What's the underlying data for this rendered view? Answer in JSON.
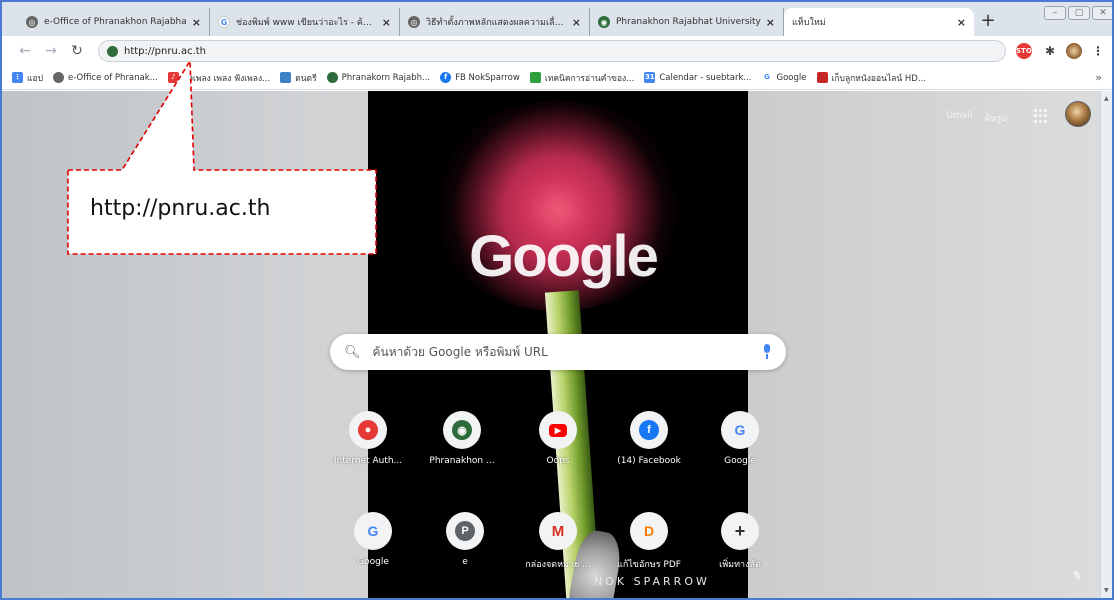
{
  "tabs": [
    {
      "title": "e-Office of Phranakhon Rajabha",
      "favicon": "globe-icon",
      "color": "#666666"
    },
    {
      "title": "ช่องพิมพ์ www เขียนว่าอะไร - ค้นหาใ",
      "favicon": "google-icon",
      "color": "#4285f4"
    },
    {
      "title": "วิธีทำตั้งภาพหลักแสดงผลความเลื่อนๆ",
      "favicon": "globe-icon",
      "color": "#666666"
    },
    {
      "title": "Phranakhon Rajabhat University",
      "favicon": "university-seal-icon",
      "color": "#2e6b3a"
    },
    {
      "title": "แท็บใหม่",
      "favicon": "",
      "color": ""
    }
  ],
  "toolbar": {
    "url": "http://pnru.ac.th",
    "extensions": [
      "stop-extension-icon",
      "puzzle-extension-icon",
      "profile-icon",
      "menu-icon"
    ]
  },
  "bookmarks": [
    {
      "label": "แอป",
      "icon": "apps-grid-icon",
      "color": "#4285f4"
    },
    {
      "label": "e-Office of Phranak...",
      "icon": "globe-icon",
      "color": "#666666"
    },
    {
      "label": "ฟังเพลง เพลง ฟังเพลง...",
      "icon": "music-icon",
      "color": "#e53935"
    },
    {
      "label": "ดนตรี",
      "icon": "paint-icon",
      "color": "#3b82c4"
    },
    {
      "label": "Phranakorn Rajabh...",
      "icon": "university-seal-icon",
      "color": "#2e6b3a"
    },
    {
      "label": "FB NokSparrow",
      "icon": "facebook-icon",
      "color": "#1877f2"
    },
    {
      "label": "เทคนิคการอ่านคำของ...",
      "icon": "people-icon",
      "color": "#2e9e3e"
    },
    {
      "label": "Calendar - suebtark...",
      "icon": "calendar-icon",
      "color": "#4285f4"
    },
    {
      "label": "Google",
      "icon": "google-icon",
      "color": "#4285f4"
    },
    {
      "label": "เก็บลูกหนังออนไลน์ HD...",
      "icon": "film-icon",
      "color": "#c62828"
    }
  ],
  "ntp": {
    "logo": "Google",
    "search_placeholder": "ค้นหาด้วย Google หรือพิมพ์ URL",
    "account_links": [
      "Gmail",
      "ค้นรูป"
    ],
    "watermark": "NOK SPARROW"
  },
  "shortcuts": [
    {
      "label": "Internet Auth...",
      "icon": "lock-icon",
      "color": "#e53935",
      "letter": "🔒"
    },
    {
      "label": "Phranakhon ...",
      "icon": "university-seal-icon",
      "color": "#2e6b3a",
      "letter": "◉"
    },
    {
      "label": "Oops",
      "icon": "youtube-icon",
      "color": "#ff0000",
      "letter": "▶"
    },
    {
      "label": "(14) Facebook",
      "icon": "facebook-icon",
      "color": "#1877f2",
      "letter": "f"
    },
    {
      "label": "Google",
      "icon": "google-icon",
      "color": "#4285f4",
      "letter": "G"
    },
    {
      "label": "Google",
      "icon": "google-icon",
      "color": "#4285f4",
      "letter": "G"
    },
    {
      "label": "e",
      "icon": "letter-p-icon",
      "color": "#5f6368",
      "letter": "P"
    },
    {
      "label": "กล่องจดหมาย ...",
      "icon": "gmail-icon",
      "color": "#d93025",
      "letter": "M"
    },
    {
      "label": "แก้ไขอักษร PDF",
      "icon": "document-icon",
      "color": "#f57c00",
      "letter": "D"
    },
    {
      "label": "เพิ่มทางลัด",
      "icon": "plus-icon",
      "color": "#333333",
      "letter": "+"
    }
  ],
  "annotation": {
    "text": "http://pnru.ac.th",
    "color": "#e00000"
  }
}
